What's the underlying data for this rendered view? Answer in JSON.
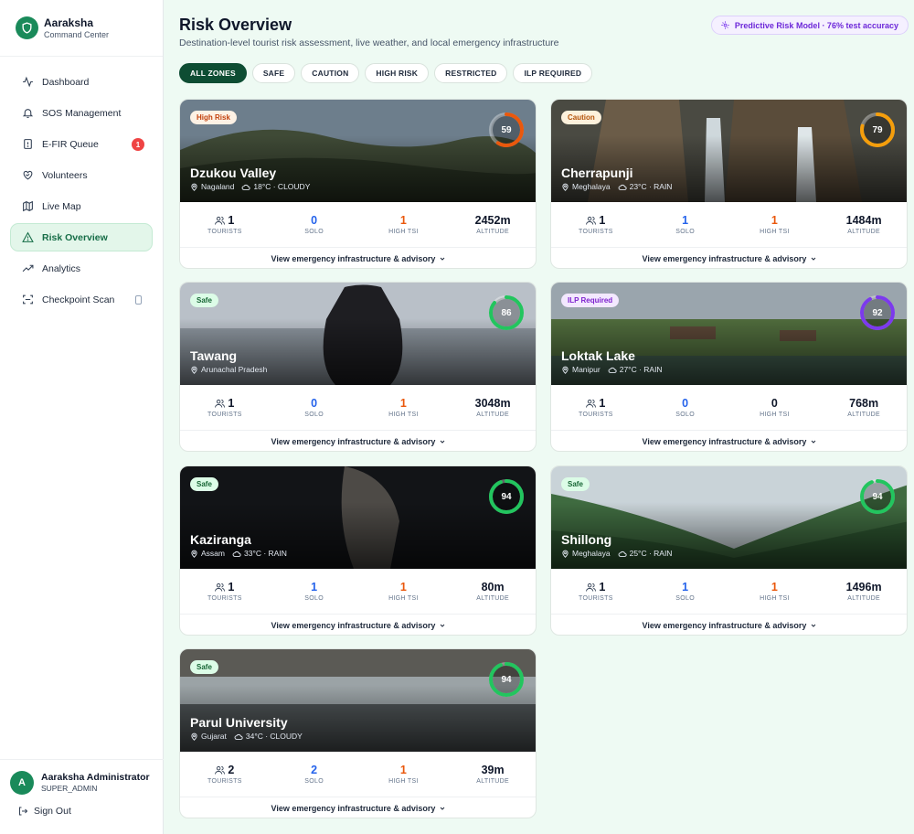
{
  "brand": {
    "name": "Aaraksha",
    "subtitle": "Command Center"
  },
  "nav": [
    {
      "label": "Dashboard",
      "icon": "activity-icon"
    },
    {
      "label": "SOS Management",
      "icon": "bell-icon"
    },
    {
      "label": "E-FIR Queue",
      "icon": "alert-file-icon",
      "badge": "1"
    },
    {
      "label": "Volunteers",
      "icon": "heart-handshake-icon"
    },
    {
      "label": "Live Map",
      "icon": "map-icon"
    },
    {
      "label": "Risk Overview",
      "icon": "alert-triangle-icon",
      "active": true
    },
    {
      "label": "Analytics",
      "icon": "trending-up-icon"
    },
    {
      "label": "Checkpoint Scan",
      "icon": "scan-icon"
    }
  ],
  "user": {
    "initial": "A",
    "name": "Aaraksha Administrator",
    "role": "SUPER_ADMIN",
    "signout": "Sign Out"
  },
  "header": {
    "title": "Risk Overview",
    "subtitle": "Destination-level tourist risk assessment, live weather, and local emergency infrastructure",
    "model_label": "Predictive Risk Model · 76% test accuracy"
  },
  "filters": [
    "ALL ZONES",
    "SAFE",
    "CAUTION",
    "HIGH RISK",
    "RESTRICTED",
    "ILP REQUIRED"
  ],
  "stat_labels": {
    "tourists": "TOURISTS",
    "solo": "SOLO",
    "high_tsi": "HIGH TSI",
    "altitude": "ALTITUDE"
  },
  "advisory_label": "View emergency infrastructure & advisory",
  "colors": {
    "accent": "#1a8a5a",
    "orange": "#ea580c",
    "amber": "#f59e0b",
    "green": "#22c55e",
    "purple": "#7c3aed"
  },
  "destinations": [
    {
      "name": "Dzukou Valley",
      "state": "Nagaland",
      "weather": "18°C · CLOUDY",
      "badge": "High Risk",
      "score": "59",
      "score_value": 59,
      "tourists": "1",
      "solo": "0",
      "high_tsi": "1",
      "altitude": "2452m"
    },
    {
      "name": "Cherrapunji",
      "state": "Meghalaya",
      "weather": "23°C · RAIN",
      "badge": "Caution",
      "score": "79",
      "score_value": 79,
      "tourists": "1",
      "solo": "1",
      "high_tsi": "1",
      "altitude": "1484m"
    },
    {
      "name": "Tawang",
      "state": "Arunachal Pradesh",
      "weather": "",
      "badge": "Safe",
      "score": "86",
      "score_value": 86,
      "tourists": "1",
      "solo": "0",
      "high_tsi": "1",
      "altitude": "3048m"
    },
    {
      "name": "Loktak Lake",
      "state": "Manipur",
      "weather": "27°C · RAIN",
      "badge": "ILP Required",
      "score": "92",
      "score_value": 92,
      "tourists": "1",
      "solo": "0",
      "high_tsi": "0",
      "altitude": "768m"
    },
    {
      "name": "Kaziranga",
      "state": "Assam",
      "weather": "33°C · RAIN",
      "badge": "Safe",
      "score": "94",
      "score_value": 94,
      "tourists": "1",
      "solo": "1",
      "high_tsi": "1",
      "altitude": "80m"
    },
    {
      "name": "Shillong",
      "state": "Meghalaya",
      "weather": "25°C · RAIN",
      "badge": "Safe",
      "score": "94",
      "score_value": 94,
      "tourists": "1",
      "solo": "1",
      "high_tsi": "1",
      "altitude": "1496m"
    },
    {
      "name": "Parul University",
      "state": "Gujarat",
      "weather": "34°C · CLOUDY",
      "badge": "Safe",
      "score": "94",
      "score_value": 94,
      "tourists": "2",
      "solo": "2",
      "high_tsi": "1",
      "altitude": "39m"
    }
  ]
}
